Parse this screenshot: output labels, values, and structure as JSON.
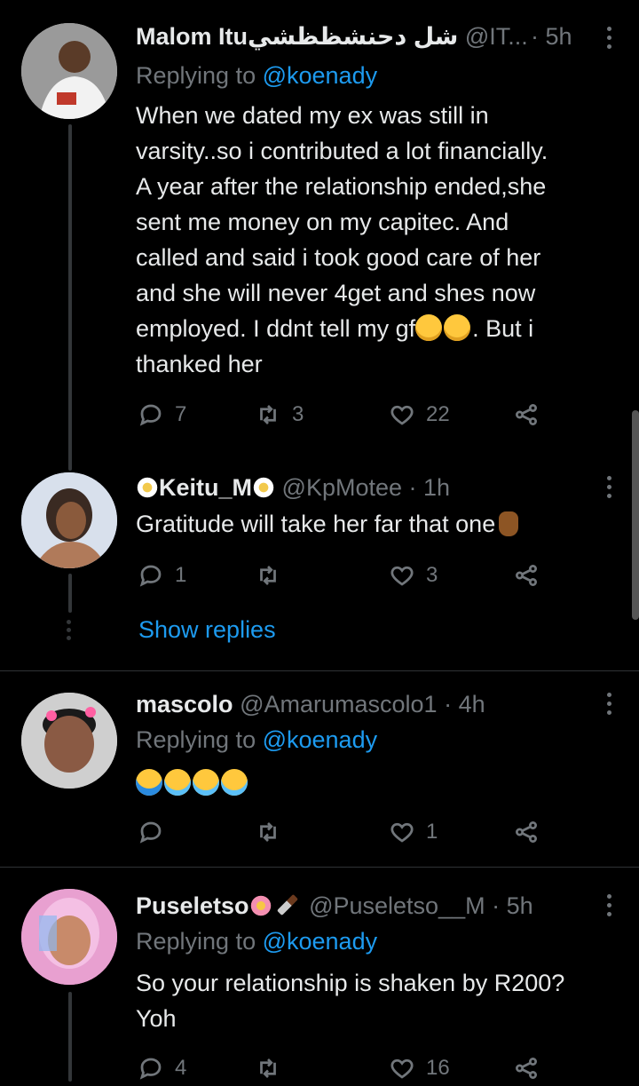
{
  "tweets": [
    {
      "name": "Malom Ituشل دحنشظظشي",
      "handle": "@IT...",
      "time": "· 5h",
      "replying_prefix": "Replying to ",
      "replying_to": "@koenady",
      "text_lines": [
        "When we dated my ex was still in",
        "varsity..so i contributed a lot financially.",
        "A year after the relationship ended,she",
        "sent me money on my capitec. And",
        "called and said i took good care of her",
        "and she will never 4get and shes now",
        "employed. I ddnt tell my gf",
        "thanked her"
      ],
      "text_line7_tail": ". But i",
      "replies": "7",
      "retweets": "3",
      "likes": "22",
      "avatar_colors": [
        "#e8e8e8",
        "#7a5a40"
      ]
    },
    {
      "name": "Keitu_M",
      "handle": "@KpMotee",
      "time": "· 1h",
      "text": "Gratitude will take her far that one",
      "replies": "1",
      "retweets": "",
      "likes": "3",
      "show_replies": "Show replies",
      "avatar_colors": [
        "#c9d6e8",
        "#3a2a22"
      ]
    },
    {
      "name": "mascolo",
      "handle": "@Amarumascolo1",
      "time": "· 4h",
      "replying_prefix": "Replying to ",
      "replying_to": "@koenady",
      "replies": "",
      "retweets": "",
      "likes": "1",
      "avatar_colors": [
        "#ddd",
        "#6b4634"
      ]
    },
    {
      "name": "Puseletso",
      "handle": "@Puseletso__M",
      "time": "· 5h",
      "replying_prefix": "Replying to ",
      "replying_to": "@koenady",
      "text_lines": [
        "So your relationship is shaken by R200?",
        "Yoh"
      ],
      "replies": "4",
      "retweets": "",
      "likes": "16",
      "avatar_colors": [
        "#e890c8",
        "#8fb8f0"
      ]
    }
  ],
  "icons": {
    "reply": "reply-icon",
    "retweet": "retweet-icon",
    "like": "heart-icon",
    "share": "share-icon",
    "more": "more-vertical-icon"
  },
  "colors": {
    "background": "#000000",
    "link": "#1d9bf0",
    "muted": "#71767b",
    "text": "#e7e9ea"
  }
}
